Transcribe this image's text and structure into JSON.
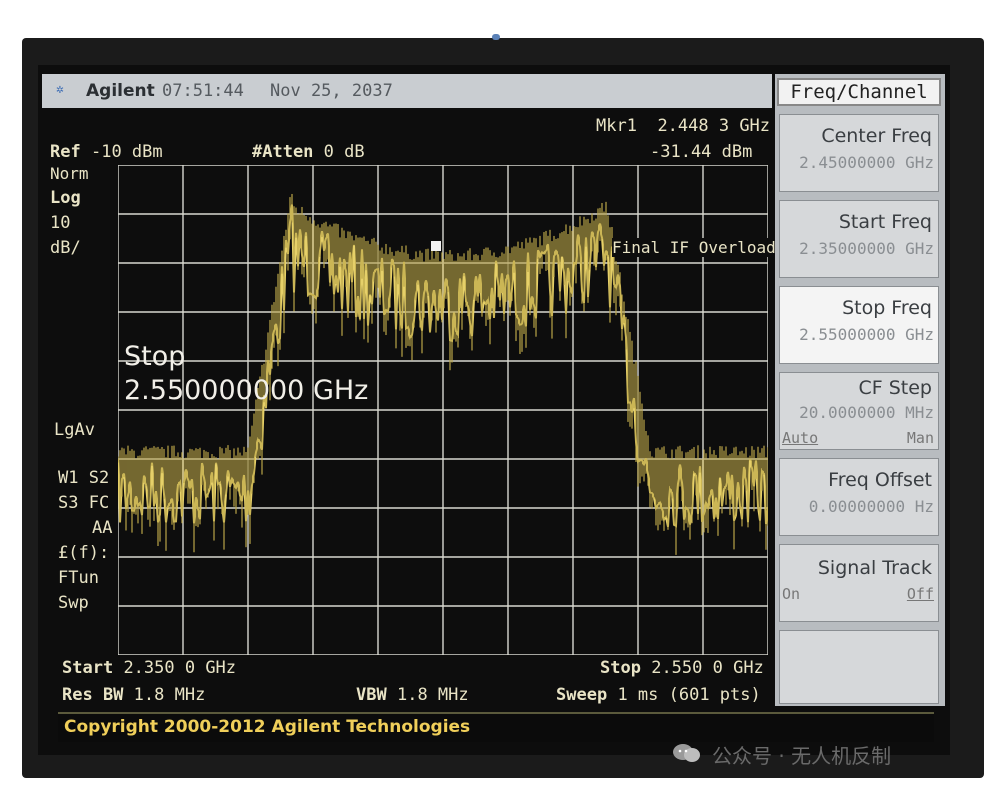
{
  "header": {
    "brand": "Agilent",
    "time": "07:51:44",
    "date": "Nov 25, 2037"
  },
  "marker": {
    "label": "Mkr1",
    "freq": "2.448 3 GHz",
    "amplitude": "-31.44 dBm"
  },
  "settings": {
    "ref_label": "Ref",
    "ref_value": "-10 dBm",
    "atten_label": "#Atten",
    "atten_value": "0 dB",
    "norm": "Norm",
    "log": "Log",
    "scale": "10",
    "scale_unit": "dB/",
    "avg": "LgAv",
    "w1s2": "W1  S2",
    "s3fc": "S3  FC",
    "aa": "AA",
    "ff": "£(f):",
    "ftun": "FTun",
    "swp": "Swp",
    "overload": "Final IF Overload"
  },
  "overlay": {
    "line1": "Stop",
    "line2": "2.550000000 GHz"
  },
  "footer": {
    "start_label": "Start",
    "start_value": "2.350 0 GHz",
    "stop_label": "Stop",
    "stop_value": "2.550 0 GHz",
    "rbw_label": "Res BW",
    "rbw_value": "1.8 MHz",
    "vbw_label": "VBW",
    "vbw_value": "1.8 MHz",
    "sweep_label": "Sweep",
    "sweep_value": "1 ms (601 pts)"
  },
  "softkeys": {
    "menu_title": "Freq/Channel",
    "center_label": "Center Freq",
    "center_value": "2.45000000 GHz",
    "start_label": "Start Freq",
    "start_value": "2.35000000 GHz",
    "stop_label": "Stop Freq",
    "stop_value": "2.55000000 GHz",
    "cfstep_label": "CF Step",
    "cfstep_value": "20.0000000 MHz",
    "cfstep_auto": "Auto",
    "cfstep_man": "Man",
    "offset_label": "Freq Offset",
    "offset_value": "0.00000000  Hz",
    "track_label": "Signal Track",
    "track_on": "On",
    "track_off": "Off"
  },
  "copyright": "Copyright 2000-2012 Agilent Technologies",
  "watermark": "公众号 · 无人机反制",
  "colors": {
    "trace": "#e6d069",
    "trace_dim": "#b9a448",
    "grid": "#d8d8d0",
    "screen": "#0d0d0d"
  }
}
